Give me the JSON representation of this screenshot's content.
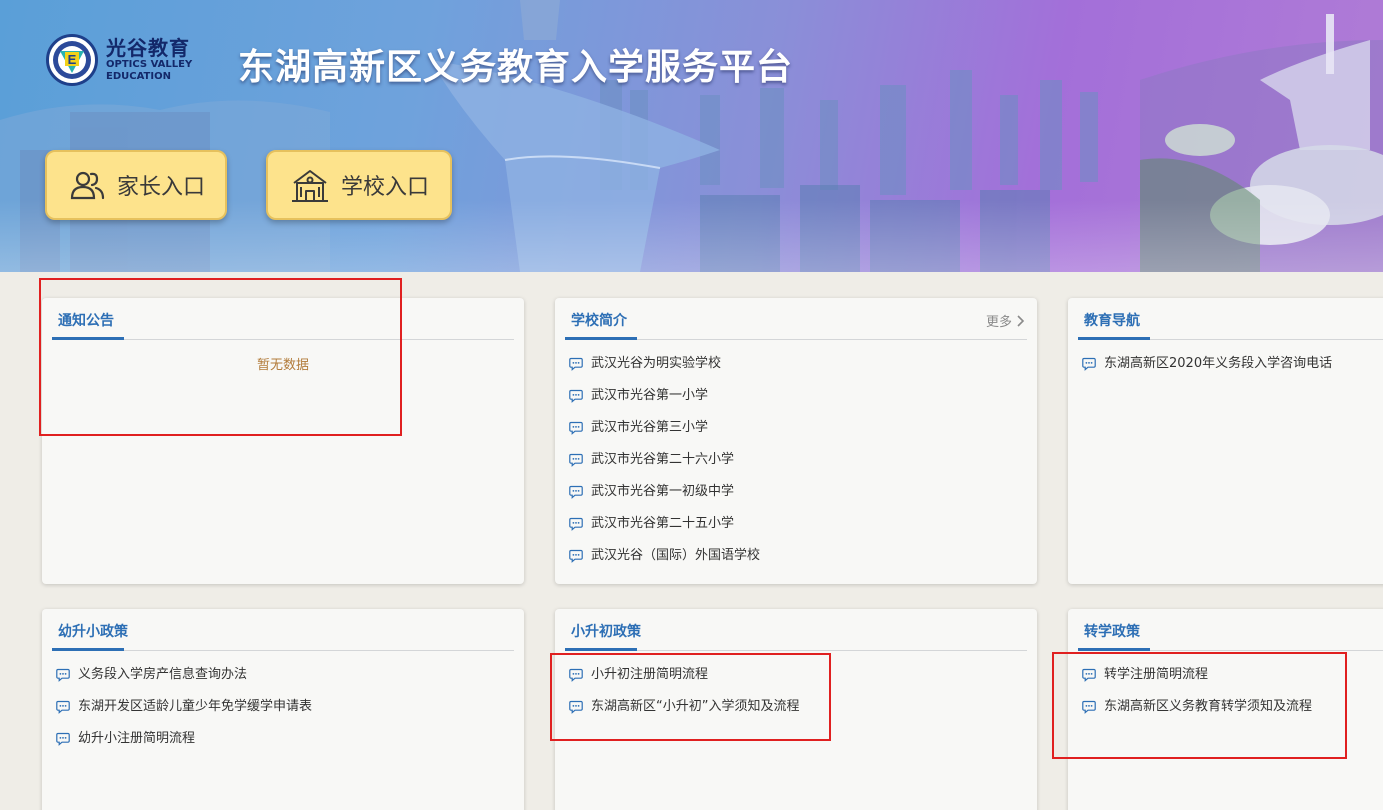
{
  "header": {
    "logo_cn": "光谷教育",
    "logo_en_line1": "OPTICS VALLEY",
    "logo_en_line2": "EDUCATION",
    "logo_letter": "E",
    "site_title": "东湖高新区义务教育入学服务平台",
    "parent_entry_label": "家长入口",
    "school_entry_label": "学校入口"
  },
  "panels": {
    "notice": {
      "title": "通知公告",
      "empty_text": "暂无数据"
    },
    "school_intro": {
      "title": "学校简介",
      "more_label": "更多",
      "items": [
        "武汉光谷为明实验学校",
        "武汉市光谷第一小学",
        "武汉市光谷第三小学",
        "武汉市光谷第二十六小学",
        "武汉市光谷第一初级中学",
        "武汉市光谷第二十五小学",
        "武汉光谷（国际）外国语学校"
      ]
    },
    "edu_nav": {
      "title": "教育导航",
      "items": [
        "东湖高新区2020年义务段入学咨询电话"
      ]
    },
    "kinder_to_primary": {
      "title": "幼升小政策",
      "items": [
        "义务段入学房产信息查询办法",
        "东湖开发区适龄儿童少年免学缓学申请表",
        "幼升小注册简明流程"
      ]
    },
    "primary_to_middle": {
      "title": "小升初政策",
      "items": [
        "小升初注册简明流程",
        "东湖高新区“小升初”入学须知及流程"
      ]
    },
    "transfer": {
      "title": "转学政策",
      "items": [
        "转学注册简明流程",
        "东湖高新区义务教育转学须知及流程"
      ]
    }
  },
  "colors": {
    "accent": "#2d6fb5",
    "entry_button": "#fde38c",
    "highlight_box": "#e02020",
    "empty_text": "#b27b3a"
  },
  "icons": {
    "list_item": "message-bubble-icon",
    "parent_entry": "people-icon",
    "school_entry": "school-building-icon",
    "more": "chevron-right-icon"
  }
}
